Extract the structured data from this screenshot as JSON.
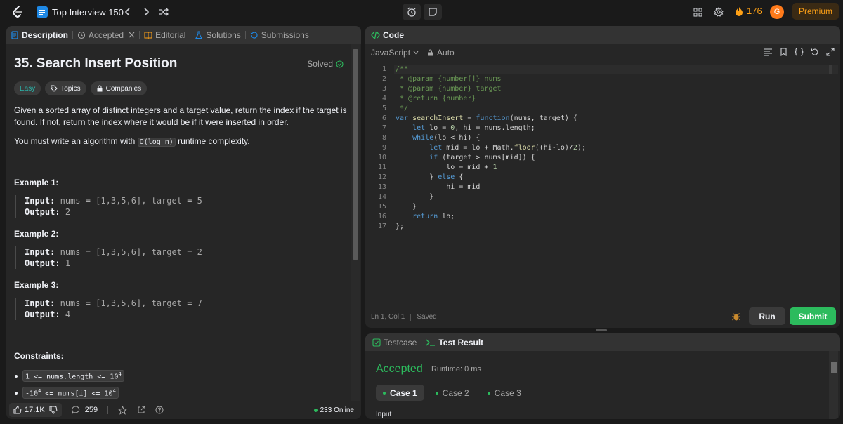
{
  "navbar": {
    "list_title": "Top Interview 150",
    "streak_count": "176",
    "avatar_initial": "G",
    "premium_label": "Premium"
  },
  "left_tabs": [
    {
      "label": "Description"
    },
    {
      "label": "Accepted"
    },
    {
      "label": "Editorial"
    },
    {
      "label": "Solutions"
    },
    {
      "label": "Submissions"
    }
  ],
  "problem": {
    "title": "35. Search Insert Position",
    "status": "Solved",
    "difficulty": "Easy",
    "topics_label": "Topics",
    "companies_label": "Companies",
    "description_p1": "Given a sorted array of distinct integers and a target value, return the index if the target is found. If not, return the index where it would be if it were inserted in order.",
    "description_p2_before": "You must write an algorithm with ",
    "description_p2_code": "O(log n)",
    "description_p2_after": " runtime complexity.",
    "examples": [
      {
        "label": "Example 1:",
        "input_label": "Input:",
        "input": "nums = [1,3,5,6], target = 5",
        "output_label": "Output:",
        "output": "2"
      },
      {
        "label": "Example 2:",
        "input_label": "Input:",
        "input": "nums = [1,3,5,6], target = 2",
        "output_label": "Output:",
        "output": "1"
      },
      {
        "label": "Example 3:",
        "input_label": "Input:",
        "input": "nums = [1,3,5,6], target = 7",
        "output_label": "Output:",
        "output": "4"
      }
    ],
    "constraints_label": "Constraints:",
    "constraint_1_a": "1 <= nums.length <= 10",
    "constraint_1_sup": "4",
    "constraint_2_a": "-10",
    "constraint_2_sup": "4",
    "constraint_2_b": " <= nums[i] <= 10",
    "constraint_2_sup2": "4"
  },
  "left_footer": {
    "likes": "17.1K",
    "comments": "259",
    "online": "233 Online"
  },
  "code_panel": {
    "title": "Code",
    "language": "JavaScript",
    "mode": "Auto",
    "cursor": "Ln 1, Col 1",
    "saved": "Saved",
    "run_label": "Run",
    "submit_label": "Submit",
    "lines": [
      {
        "n": "1",
        "t": "/**"
      },
      {
        "n": "2",
        "t": " * @param {number[]} nums"
      },
      {
        "n": "3",
        "t": " * @param {number} target"
      },
      {
        "n": "4",
        "t": " * @return {number}"
      },
      {
        "n": "5",
        "t": " */"
      },
      {
        "n": "6",
        "t": "var searchInsert = function(nums, target) {"
      },
      {
        "n": "7",
        "t": "    let lo = 0, hi = nums.length;"
      },
      {
        "n": "8",
        "t": "    while(lo < hi) {"
      },
      {
        "n": "9",
        "t": "        let mid = lo + Math.floor((hi-lo)/2);"
      },
      {
        "n": "10",
        "t": "        if (target > nums[mid]) {"
      },
      {
        "n": "11",
        "t": "            lo = mid + 1"
      },
      {
        "n": "12",
        "t": "        } else {"
      },
      {
        "n": "13",
        "t": "            hi = mid"
      },
      {
        "n": "14",
        "t": "        }"
      },
      {
        "n": "15",
        "t": "    }"
      },
      {
        "n": "16",
        "t": "    return lo;"
      },
      {
        "n": "17",
        "t": "};"
      }
    ]
  },
  "result_panel": {
    "testcase_tab": "Testcase",
    "result_tab": "Test Result",
    "verdict": "Accepted",
    "runtime": "Runtime: 0 ms",
    "cases": [
      "Case 1",
      "Case 2",
      "Case 3"
    ],
    "input_label": "Input"
  },
  "colors": {
    "accent_orange": "#ffa116",
    "success_green": "#2cbb5d",
    "easy_teal": "#2bb6ab"
  }
}
